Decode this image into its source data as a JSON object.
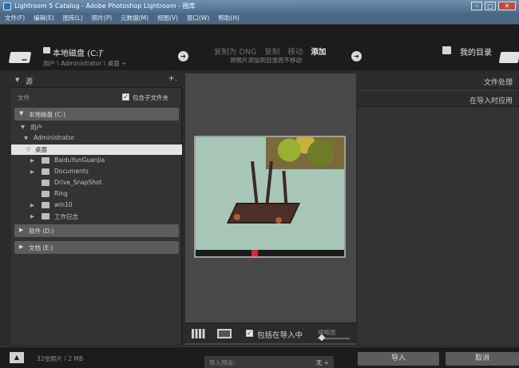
{
  "window": {
    "title": "Lightroom 5 Catalog - Adobe Photoshop Lightroom - 图库",
    "controls": [
      "–",
      "□",
      "✕"
    ]
  },
  "menu": [
    "文件(F)",
    "编辑(E)",
    "图库(L)",
    "照片(P)",
    "元数据(M)",
    "视图(V)",
    "窗口(W)",
    "帮助(H)"
  ],
  "header": {
    "source_title": "本地磁盘 (C:)",
    "source_caret": "÷",
    "source_path": "用户 \\ Administrator \\ 桌面 ÷",
    "modes": [
      "复制为 DNG",
      "复制",
      "移动",
      "添加"
    ],
    "active_mode": "添加",
    "mode_description": "将照片添加到目录而不移动",
    "destination_title": "我的目录",
    "arrow_glyph": "➜"
  },
  "source_panel": {
    "title": "源",
    "add_button": "+.",
    "files_label": "文件",
    "include_subfolders_label": "包含子文件夹",
    "include_subfolders_checked": true,
    "volumes": [
      {
        "label": "本地磁盘 (C:)",
        "expanded": true
      },
      {
        "label": "软件 (D:)",
        "expanded": false
      },
      {
        "label": "文档 (E:)",
        "expanded": false
      }
    ],
    "tree": [
      {
        "label": "用户",
        "level": 1,
        "arrow": "▼",
        "folder": false,
        "selected": false
      },
      {
        "label": "Administrator",
        "level": 2,
        "arrow": "▼",
        "folder": false,
        "selected": false
      },
      {
        "label": "桌面",
        "level": 3,
        "arrow": "▽",
        "folder": false,
        "selected": true
      },
      {
        "label": "BaiduYunGuanjia",
        "level": 4,
        "arrow": "▶",
        "folder": true,
        "selected": false
      },
      {
        "label": "Documents",
        "level": 4,
        "arrow": "▶",
        "folder": true,
        "selected": false
      },
      {
        "label": "Drive_SnapShot",
        "level": 4,
        "arrow": "",
        "folder": true,
        "selected": false
      },
      {
        "label": "Ring",
        "level": 4,
        "arrow": "",
        "folder": true,
        "selected": false
      },
      {
        "label": "win10",
        "level": 4,
        "arrow": "▶",
        "folder": true,
        "selected": false
      },
      {
        "label": "工作日志",
        "level": 4,
        "arrow": "▶",
        "folder": true,
        "selected": false
      }
    ]
  },
  "center": {
    "include_in_import_label": "包括在导入中",
    "include_in_import_checked": true,
    "sort_label": "缩略图"
  },
  "right_panel": {
    "sections": [
      "文件处理",
      "在导入时应用"
    ]
  },
  "bottom": {
    "collapse_button": "▲",
    "photo_count": "32张照片 / 2 MB",
    "import_preset_label": "导入预设:",
    "import_preset_value": "无 ÷",
    "import_button": "导入",
    "cancel_button": "取消"
  },
  "colors": {
    "selected_row": "#e4e4e4",
    "panel": "#333333",
    "header": "#1c1c1c",
    "titlebar": "#4e6e8f"
  }
}
